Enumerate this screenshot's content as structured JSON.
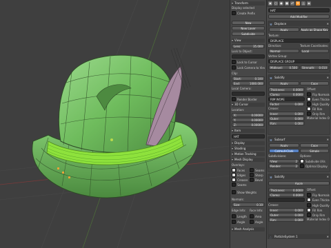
{
  "tool_shelf": {
    "transform": "Transform",
    "display_selected": "Display selected",
    "create_cube": "Create Prefix",
    "new_btn": "New",
    "new_layer": "New Layer",
    "subdivide": "Subdivide",
    "view": "View",
    "lens_label": "Lens:",
    "lens_value": "35.000",
    "lock_to_object": "Lock to Object:",
    "lock_to_cursor": "Lock to Cursor",
    "lock_camera": "Lock Camera to View",
    "clip": "Clip:",
    "start_label": "Start:",
    "start_value": "0.100",
    "end_label": "End:",
    "end_value": "1000.000",
    "local_camera": "Local Camera:",
    "render_border": "Render Border",
    "cursor_3d": "3D Cursor",
    "location": "Location:",
    "x_label": "X:",
    "x_value": "0.00000",
    "y_label": "Y:",
    "y_value": "0.00000",
    "z_label": "Z:",
    "z_value": "0.00000",
    "item": "Item",
    "hat_name": "HAT",
    "display": "Display",
    "shading": "Shading",
    "motion_tracking": "Motion Tracking",
    "mesh_display": "Mesh Display",
    "overlays": "Overlays:",
    "faces": "Faces",
    "seams": "Seams",
    "sharp": "Sharp",
    "creases": "Creases",
    "bevel": "Bevel",
    "edges": "Edges",
    "show_weights": "Show Weights",
    "normals": "Normals:",
    "size_label": "Size:",
    "size_value": "0.10",
    "edge_info": "Edge Info:",
    "face_info": "Face Info:",
    "length": "Length",
    "area": "Area",
    "angle": "Angle",
    "angle2": "Angle",
    "mesh_analysis": "Mesh Analysis"
  },
  "properties": {
    "tabs": [
      "render-icon",
      "scene-icon",
      "world-icon",
      "object-icon",
      "constraint-icon",
      "modifier-icon",
      "data-icon",
      "material-icon"
    ],
    "object_name": "HAT",
    "add_modifier": "Add Modifier",
    "displace": {
      "title": "Displace",
      "apply": "Apply",
      "apply_shape": "Apply as Shape Key",
      "texture": "Texture:",
      "texture_value": "DISPLACE",
      "direction": "Direction:",
      "direction_value": "Normal",
      "texture_coords": "Texture Coordinates:",
      "texture_coords_value": "Local",
      "vertex_group": "Vertex Group:",
      "vertex_group_value": "DISPLACE GROUP",
      "midlevel_label": "Midlevel:",
      "midlevel_value": "0.500",
      "strength_label": "Strength:",
      "strength_value": "0.010"
    },
    "solidify": {
      "title": "Solidify",
      "apply": "Apply",
      "copy": "Copy",
      "thickness_label": "Thickness:",
      "thickness_value": "0.0000",
      "clamp_label": "Clamp:",
      "clamp_value": "0.0000",
      "offset_label": "Offset:",
      "flip_normals": "Flip Normals",
      "even_thickness": "Even Thickness",
      "high_quality": "High Quality",
      "fill_rim": "Fill Rim",
      "only_rim": "Only Rim",
      "vertex_group_value": "RIM WOPE",
      "factor_label": "Factor:",
      "factor_value": "0.000",
      "crease_label": "Crease:",
      "inner_label": "Inner:",
      "inner_value": "0.000",
      "outer_label": "Outer:",
      "outer_value": "0.000",
      "rim_label": "Rim:",
      "rim_value": "0.000",
      "material_index": "Material Index Offset:"
    },
    "subsurf": {
      "title": "Subsurf",
      "apply": "Apply",
      "copy": "Copy",
      "catmull": "Catmull-Clark",
      "simple": "Simple",
      "subdivisions": "Subdivisions:",
      "view_label": "View:",
      "view_value": "2",
      "render_label": "Render:",
      "render_value": "2",
      "options": "Options:",
      "subdivide_uvs": "Subdivide UVs",
      "optimal_display": "Optimal Display"
    },
    "solidify2": {
      "title": "Solidify",
      "apply": "Apply",
      "thickness_label": "Thickness:",
      "thickness_value": "0.0000",
      "clamp_label": "Clamp:",
      "clamp_value": "0.0000",
      "offset_label": "Offset:",
      "flip_normals": "Flip Normals",
      "even_thickness": "Even Thickness",
      "high_quality": "High Quality",
      "fill_rim": "Fill Rim",
      "only_rim": "Only Rim",
      "crease_label": "Crease:",
      "inner_label": "Inner:",
      "inner_value": "0.000",
      "outer_label": "Outer:",
      "outer_value": "0.000",
      "rim_label": "Rim:",
      "rim_value": "0.000",
      "material_index": "Material Index Offset:",
      "particle_system": "ParticleSystem 1"
    }
  },
  "colors": {
    "viewport_bg": "#3f3f3f",
    "mesh_green": "#7cc86a",
    "wire_dark": "#2e4a26",
    "band_green": "#8ee23c",
    "feather": "#a68aa0",
    "accent_blue": "#5680c2",
    "active_tab": "#ff9a2e"
  }
}
